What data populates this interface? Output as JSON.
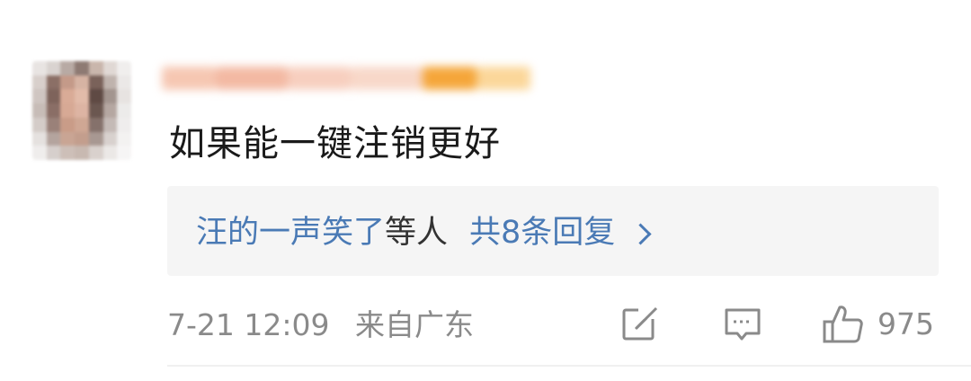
{
  "comment": {
    "username": "",
    "content": "如果能一键注销更好",
    "replies": {
      "names": "汪的一声笑了",
      "suffix": "等人",
      "total": "共8条回复"
    },
    "meta": {
      "time": "7-21 12:09",
      "source": "来自广东"
    },
    "actions": {
      "share_icon": "edit-share-icon",
      "comment_icon": "comment-icon",
      "like_icon": "thumbs-up-icon",
      "like_count": "975"
    }
  },
  "colors": {
    "link": "#4a7ab5",
    "meta_gray": "#8a8a8a",
    "reply_bg": "#f5f5f5"
  }
}
